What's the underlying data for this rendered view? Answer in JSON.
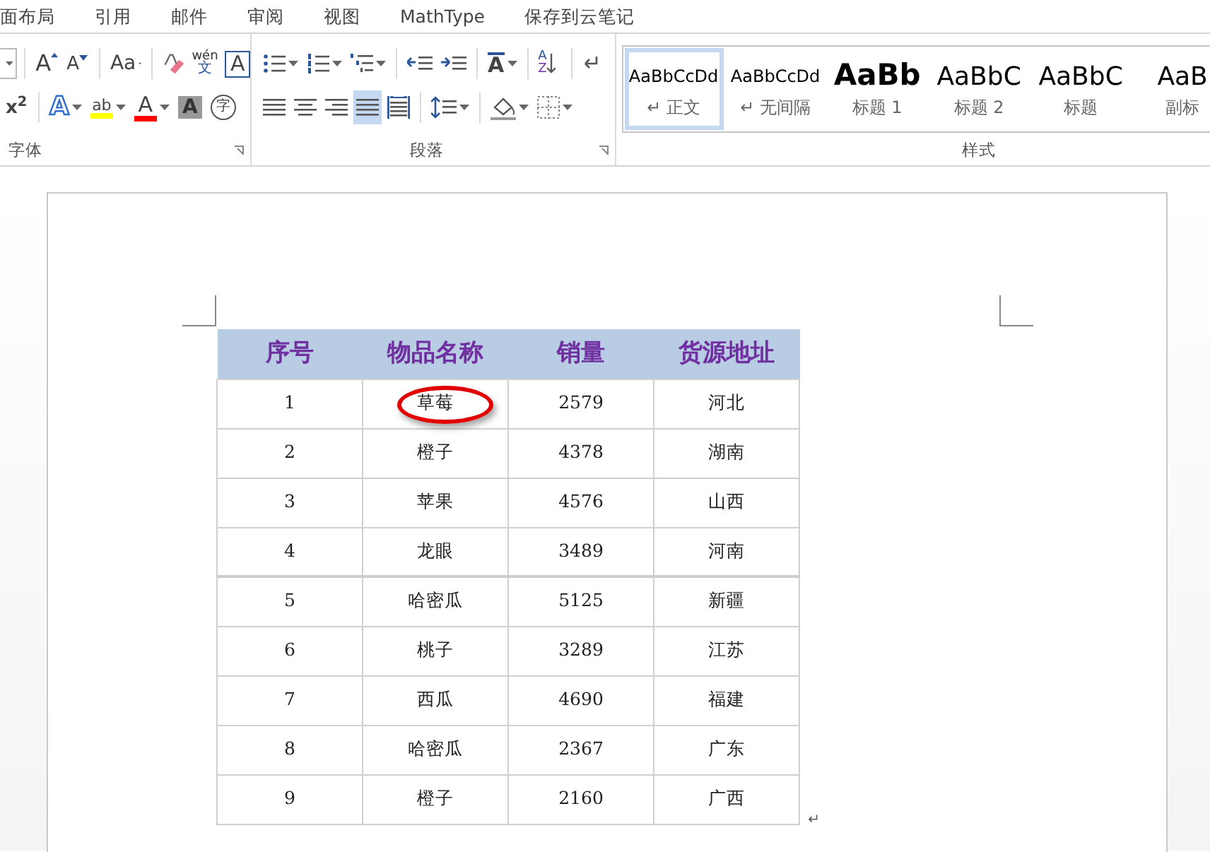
{
  "menu_tabs": [
    {
      "label": "面布局",
      "selected": false
    },
    {
      "label": "引用",
      "selected": false
    },
    {
      "label": "邮件",
      "selected": false
    },
    {
      "label": "审阅",
      "selected": false
    },
    {
      "label": "视图",
      "selected": false
    },
    {
      "label": "MathType",
      "selected": false
    },
    {
      "label": "保存到云笔记",
      "selected": false
    }
  ],
  "font_group": {
    "label": "字体",
    "row1": [
      {
        "kind": "size_tail"
      },
      {
        "kind": "grow",
        "text": "A"
      },
      {
        "kind": "shrink",
        "text": "A"
      },
      {
        "kind": "case",
        "text": "Aa"
      },
      {
        "kind": "clear"
      },
      {
        "kind": "phonetic",
        "text": "wén",
        "sub": "文"
      },
      {
        "kind": "border",
        "text": "A"
      }
    ],
    "row2": [
      {
        "kind": "superscript",
        "text": "x$^{2}$"
      },
      {
        "kind": "effect",
        "text": "A"
      },
      {
        "kind": "highlight",
        "text": "ab",
        "color": "#ffff00"
      },
      {
        "kind": "fontcolor",
        "text": "A",
        "color": "#ff0000"
      },
      {
        "kind": "shading",
        "text": "A"
      },
      {
        "kind": "enclose",
        "text": "字"
      }
    ]
  },
  "paragraph_group": {
    "label": "段落",
    "row1": [
      {
        "kind": "bullets"
      },
      {
        "kind": "numbering"
      },
      {
        "kind": "multilevel"
      },
      {
        "kind": "outdent"
      },
      {
        "kind": "indent"
      },
      {
        "kind": "asian",
        "text": "A"
      },
      {
        "kind": "sort",
        "text": "A",
        "sub": "Z"
      },
      {
        "kind": "marks"
      }
    ],
    "alignment": [
      {
        "kind": "left",
        "selected": false
      },
      {
        "kind": "center",
        "selected": false
      },
      {
        "kind": "right",
        "selected": false
      },
      {
        "kind": "justify",
        "selected": true
      },
      {
        "kind": "distributed",
        "selected": false
      }
    ],
    "row2": [
      {
        "kind": "spacing"
      },
      {
        "kind": "fill"
      },
      {
        "kind": "borders"
      }
    ]
  },
  "styles_group": {
    "label": "样式",
    "styles": [
      {
        "kind": "body",
        "preview": "AaBbCcDd",
        "mark": "↵",
        "name": "正文",
        "selected": true
      },
      {
        "kind": "body",
        "preview": "AaBbCcDd",
        "mark": "↵",
        "name": "无间隔",
        "selected": false
      },
      {
        "kind": "heading1",
        "preview": "AaBb",
        "name": "标题 1",
        "selected": false
      },
      {
        "kind": "heading2",
        "preview": "AaBbC",
        "name": "标题 2",
        "selected": false
      },
      {
        "kind": "heading2",
        "preview": "AaBbC",
        "name": "标题",
        "selected": false
      },
      {
        "kind": "heading2",
        "preview": "AaB",
        "name": "副标",
        "selected": false
      }
    ]
  },
  "table": {
    "columns": [
      "序号",
      "物品名称",
      "销量",
      "货源地址"
    ],
    "rows": [
      {
        "cells": [
          "1",
          "草莓",
          "2579",
          "河北"
        ],
        "circled": true
      },
      {
        "cells": [
          "2",
          "橙子",
          "4378",
          "湖南"
        ],
        "circled": false
      },
      {
        "cells": [
          "3",
          "苹果",
          "4576",
          "山西"
        ],
        "circled": false
      },
      {
        "cells": [
          "4",
          "龙眼",
          "3489",
          "河南"
        ],
        "circled": false
      },
      {
        "cells": [
          "5",
          "哈密瓜",
          "5125",
          "新疆"
        ],
        "circled": false
      },
      {
        "cells": [
          "6",
          "桃子",
          "3289",
          "江苏"
        ],
        "circled": false
      },
      {
        "cells": [
          "7",
          "西瓜",
          "4690",
          "福建"
        ],
        "circled": false
      },
      {
        "cells": [
          "8",
          "哈密瓜",
          "2367",
          "广东"
        ],
        "circled": false
      },
      {
        "cells": [
          "9",
          "橙子",
          "2160",
          "广西"
        ],
        "circled": false
      }
    ],
    "end_mark": "↵"
  }
}
